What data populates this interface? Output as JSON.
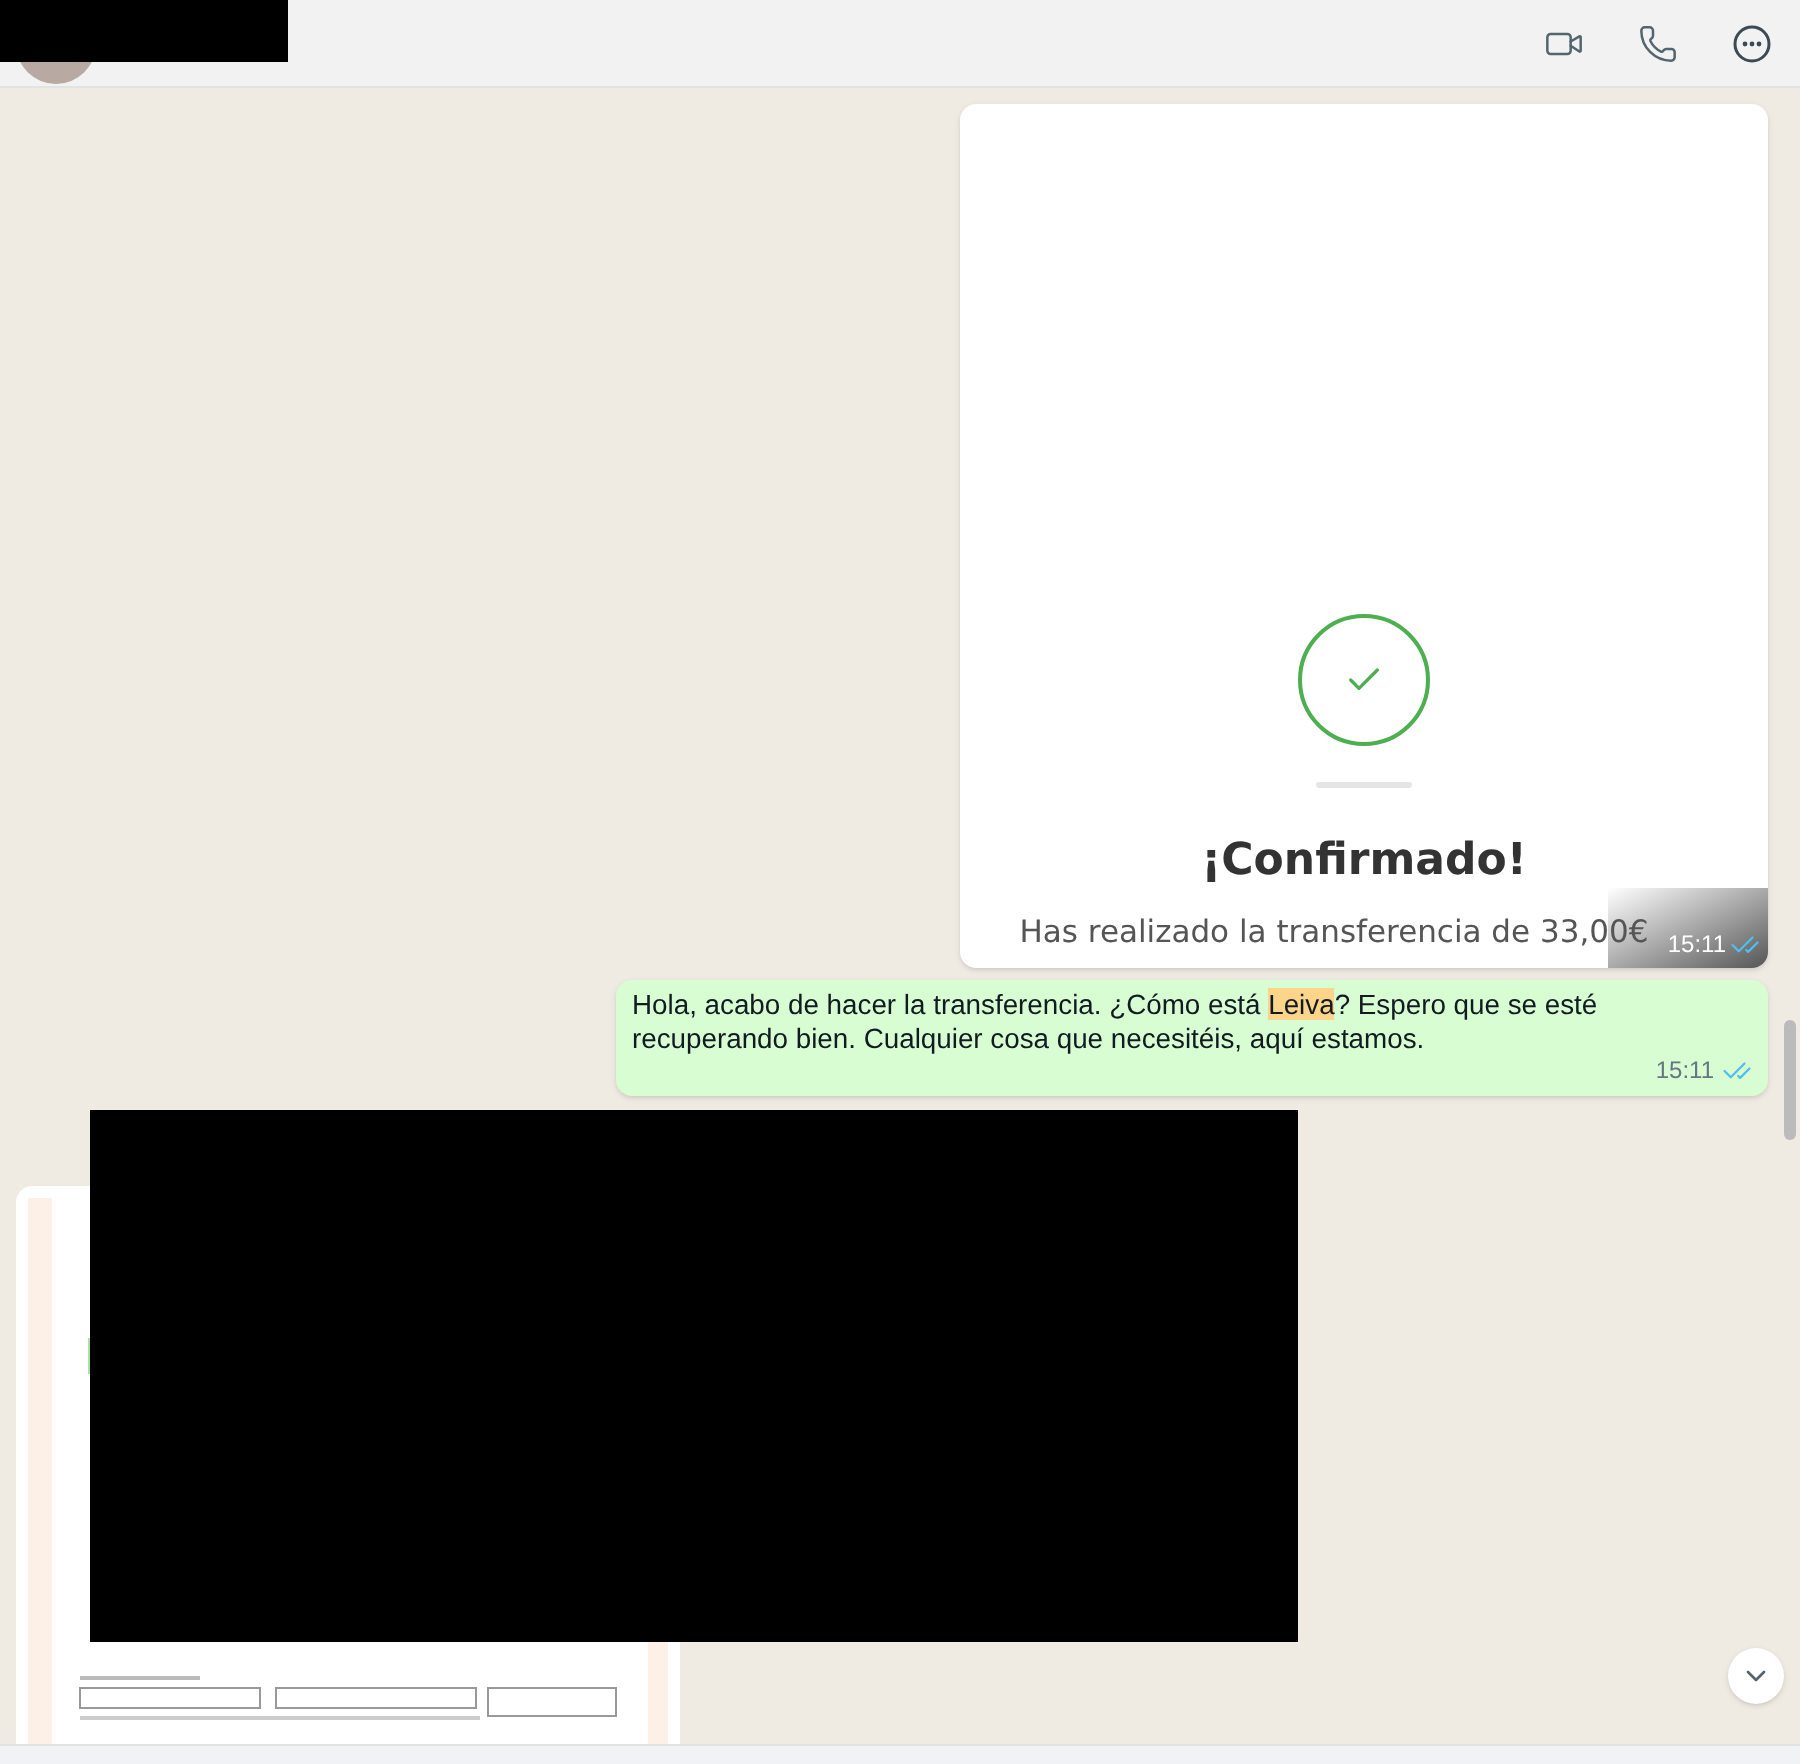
{
  "header": {
    "actions": [
      {
        "kind": "video"
      },
      {
        "kind": "phone"
      },
      {
        "kind": "more"
      }
    ]
  },
  "messages": [
    {
      "kind": "image",
      "title": "¡Confirmado!",
      "subtitle": "Has realizado la transferencia de 33,00€",
      "time": "15:11",
      "read": true
    },
    {
      "kind": "text",
      "parts": [
        {
          "text": "Hola, acabo de hacer la transferencia. ¿Cómo está ",
          "highlight": false
        },
        {
          "text": "Leiva",
          "highlight": true
        },
        {
          "text": "? Espero que se esté recuperando bien. Cualquier cosa que necesitéis, aquí estamos.",
          "highlight": false
        }
      ],
      "time": "15:11",
      "read": true
    },
    {
      "kind": "document"
    }
  ]
}
